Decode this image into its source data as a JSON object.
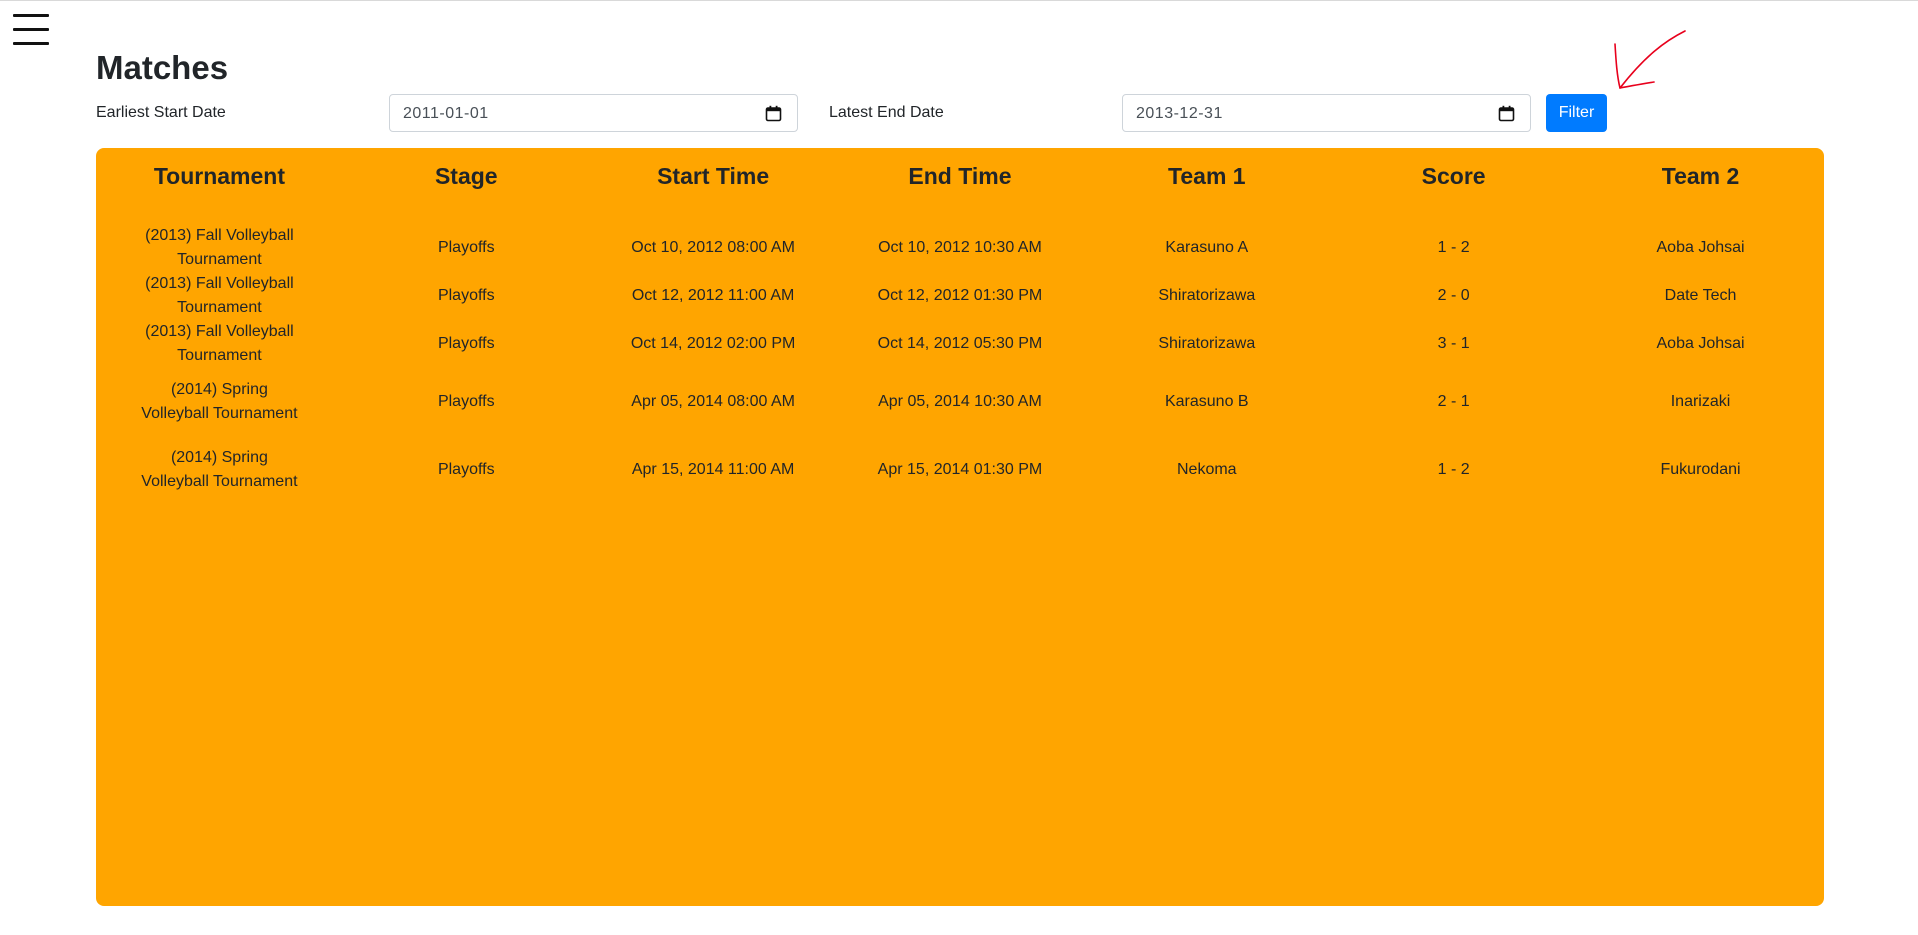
{
  "page": {
    "title": "Matches"
  },
  "filters": {
    "start_label": "Earliest Start Date",
    "start_value": "2011-01-01",
    "end_label": "Latest End Date",
    "end_value": "2013-12-31",
    "button_label": "Filter"
  },
  "table": {
    "background_color": "#ffa500",
    "headers": [
      "Tournament",
      "Stage",
      "Start Time",
      "End Time",
      "Team 1",
      "Score",
      "Team 2"
    ],
    "rows": [
      {
        "tournament": "(2013) Fall Volleyball Tournament",
        "stage": "Playoffs",
        "start": "Oct 10, 2012 08:00 AM",
        "end": "Oct 10, 2012 10:30 AM",
        "team1": "Karasuno A",
        "score": "1 - 2",
        "team2": "Aoba Johsai"
      },
      {
        "tournament": "(2013) Fall Volleyball Tournament",
        "stage": "Playoffs",
        "start": "Oct 12, 2012 11:00 AM",
        "end": "Oct 12, 2012 01:30 PM",
        "team1": "Shiratorizawa",
        "score": "2 - 0",
        "team2": "Date Tech"
      },
      {
        "tournament": "(2013) Fall Volleyball Tournament",
        "stage": "Playoffs",
        "start": "Oct 14, 2012 02:00 PM",
        "end": "Oct 14, 2012 05:30 PM",
        "team1": "Shiratorizawa",
        "score": "3 - 1",
        "team2": "Aoba Johsai"
      },
      {
        "tournament": "(2014) Spring Volleyball Tournament",
        "stage": "Playoffs",
        "start": "Apr 05, 2014 08:00 AM",
        "end": "Apr 05, 2014 10:30 AM",
        "team1": "Karasuno B",
        "score": "2 - 1",
        "team2": "Inarizaki"
      },
      {
        "tournament": "(2014) Spring Volleyball Tournament",
        "stage": "Playoffs",
        "start": "Apr 15, 2014 11:00 AM",
        "end": "Apr 15, 2014 01:30 PM",
        "team1": "Nekoma",
        "score": "1 - 2",
        "team2": "Fukurodani"
      }
    ]
  },
  "icons": {
    "menu": "hamburger-menu-icon",
    "date_picker": "calendar-icon",
    "annotation": "red-arrow-annotation"
  },
  "colors": {
    "primary_button": "#007bff",
    "annotation": "#e8001c"
  }
}
